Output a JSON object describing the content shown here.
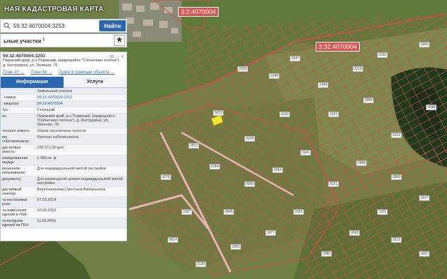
{
  "map": {
    "title": "НАЯ КАДАСТРОВАЯ КАРТА",
    "badges": [
      {
        "text": "3:2:4070004"
      },
      {
        "text": "3:32:4070004"
      }
    ],
    "plot_labels": [
      "3253",
      "3348",
      "3247",
      "3200",
      "3194",
      "3318",
      "3150",
      "2950",
      "3101",
      "3092",
      "3141",
      "3054",
      "3000",
      "3184",
      "2912",
      "3276",
      "3167",
      "3045",
      "3077",
      "3155",
      "3121",
      "2998",
      "3089",
      "3207",
      "3115",
      "3032",
      "2985",
      "3233",
      "3061",
      "2965",
      "3014",
      "3120",
      "3199",
      "3103",
      "3048",
      "3130"
    ]
  },
  "panel": {
    "search": {
      "value": "59:32:4070004:3253",
      "button": "Найти"
    },
    "results_header": {
      "text": "ьные участки",
      "count": "1"
    },
    "card": {
      "number": "59:32:4070004:3253",
      "address": "Пермский край, р-н Пермский, (микрорайон \"Солнечная поляна\"), д. Кострурина, ул. Зеленая, 76",
      "links": [
        "План ЗУ →",
        "План КК →",
        "Поиск в границах объекта →"
      ],
      "tabs": {
        "active": "Информация",
        "other": "Услуги"
      },
      "rows": [
        {
          "k": "",
          "v": "Земельный участок",
          "link": false
        },
        {
          "k": ". номер:",
          "v": "59:32:4070004:3253",
          "link": true
        },
        {
          "k": ". квартал:",
          "v": "59:32:4070004",
          "link": true
        },
        {
          "k": "тус:",
          "v": "Учтенный",
          "link": false
        },
        {
          "k": "ес:",
          "v": "Пермский край, р-н Пермский, (микрорайон \"Солнечная поляна\"), д. Кострурина, ул. Зеленая, 76",
          "link": false
        },
        {
          "k": "тегория земель:",
          "v": "Земли населённых пунктов",
          "link": false
        },
        {
          "k": "ма собственности:",
          "v": "Частная собственность",
          "link": false
        },
        {
          "k": "дастровая имость:",
          "v": "238 571,00 руб.",
          "link": false
        },
        {
          "k": "ланированная ощадь:",
          "v": "1 050 кв. м",
          "link": false
        },
        {
          "k": "решенное пользование:",
          "v": "Для индивидуальной жилой застройки",
          "link": false
        },
        {
          "k": "документу:",
          "v": "Для размещения домов индивидуальной жилой застройки",
          "link": false
        },
        {
          "k": "дастровый нженер:",
          "v": "Веретенникова Светлана Валерьевна",
          "link": false
        },
        {
          "k": "та постановки учет:",
          "v": "07.02.2014",
          "link": false
        },
        {
          "k": "та изменения едений в ГКН:",
          "v": "10.03.2016",
          "link": false
        },
        {
          "k": "та выгрузки едений из ГКН:",
          "v": "11.03.2016",
          "link": false
        }
      ]
    }
  },
  "colors": {
    "accent": "#2a67b3",
    "plot_line": "#d94a4a",
    "highlight": "#f2e632"
  }
}
